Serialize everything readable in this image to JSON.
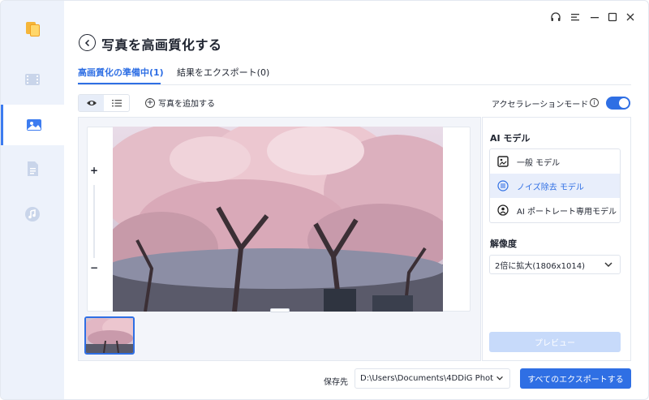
{
  "window": {
    "page_title": "写真を高画質化する"
  },
  "sidebar": {
    "items": [
      {
        "icon": "video-icon",
        "active": false
      },
      {
        "icon": "image-icon",
        "active": true
      },
      {
        "icon": "document-icon",
        "active": false
      },
      {
        "icon": "music-icon",
        "active": false
      }
    ]
  },
  "tabs": [
    {
      "label": "高画質化の準備中(1)",
      "active": true
    },
    {
      "label": "結果をエクスポート(0)",
      "active": false
    }
  ],
  "toolbar": {
    "add_photo_label": "写真を追加する",
    "accel_label": "アクセラレーションモード",
    "accel_on": true
  },
  "preview": {
    "zoom_in": "+",
    "zoom_out": "−"
  },
  "right_panel": {
    "ai_model_label": "AI モデル",
    "models": [
      {
        "label": "一般 モデル",
        "icon": "image-frame-icon",
        "selected": false
      },
      {
        "label": "ノイズ除去 モデル",
        "icon": "denoise-icon",
        "selected": true
      },
      {
        "label": "AI ポートレート専用モデル",
        "icon": "portrait-icon",
        "selected": false
      }
    ],
    "resolution_label": "解像度",
    "resolution_value": "2倍に拡大(1806x1014)",
    "preview_button": "プレビュー"
  },
  "footer": {
    "save_label": "保存先",
    "save_path": "D:\\Users\\Documents\\4DDiG Phot...",
    "export_all": "すべてのエクスポートする"
  },
  "colors": {
    "accent": "#2f6fe4",
    "sidebar_bg": "#edf2fb",
    "preview_disabled": "#c7dafa"
  }
}
